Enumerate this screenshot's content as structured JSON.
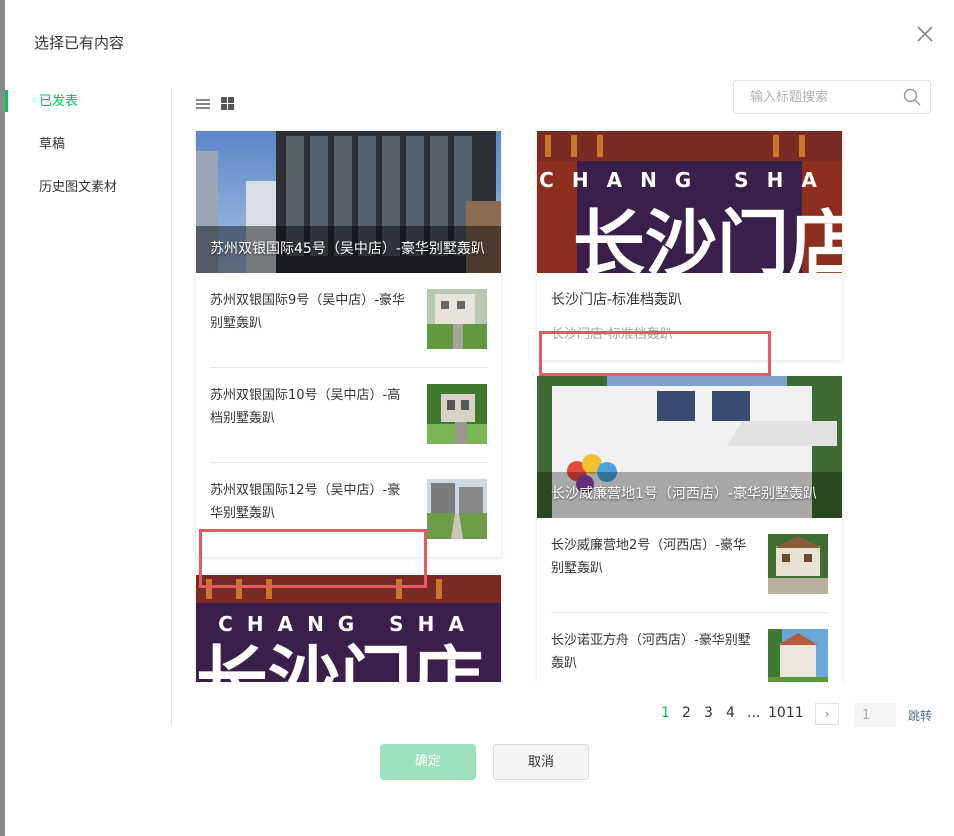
{
  "dialog": {
    "title": "选择已有内容"
  },
  "nav": {
    "items": [
      {
        "label": "已发表",
        "active": true
      },
      {
        "label": "草稿"
      },
      {
        "label": "历史图文素材"
      }
    ]
  },
  "search": {
    "placeholder": "输入标题搜索"
  },
  "cards": {
    "c1": {
      "cover_title": "苏州双银国际45号（吴中店）-豪华别墅轰趴",
      "items": [
        {
          "title": "苏州双银国际9号（吴中店）-豪华别墅轰趴"
        },
        {
          "title": "苏州双银国际10号（吴中店）-高档别墅轰趴"
        },
        {
          "title": "苏州双银国际12号（吴中店）-豪华别墅轰趴"
        }
      ]
    },
    "c2": {
      "cover_text_top": "CHANG SHA",
      "cover_text_big": "长沙门店",
      "title": "长沙门店-标准档轰趴",
      "digest": "长沙门店-标准档轰趴"
    },
    "c3": {
      "cover_title": "长沙威廉营地1号（河西店）-豪华别墅轰趴",
      "items": [
        {
          "title": "长沙威廉营地2号（河西店）-豪华别墅轰趴"
        },
        {
          "title": "长沙诺亚方舟（河西店）-豪华别墅轰趴"
        }
      ]
    },
    "c4": {
      "cover_text_top": "CHANG SHA",
      "cover_text_big": "长沙门店"
    }
  },
  "pagination": {
    "pages": [
      "1",
      "2",
      "3",
      "4",
      "...",
      "1011"
    ],
    "current": "1",
    "jump_value": "1",
    "jump_label": "跳转",
    "next_symbol": "›"
  },
  "buttons": {
    "ok": "确定",
    "cancel": "取消"
  },
  "colors": {
    "accent": "#07c160",
    "highlight": "#e95a5e",
    "link": "#576b95"
  }
}
